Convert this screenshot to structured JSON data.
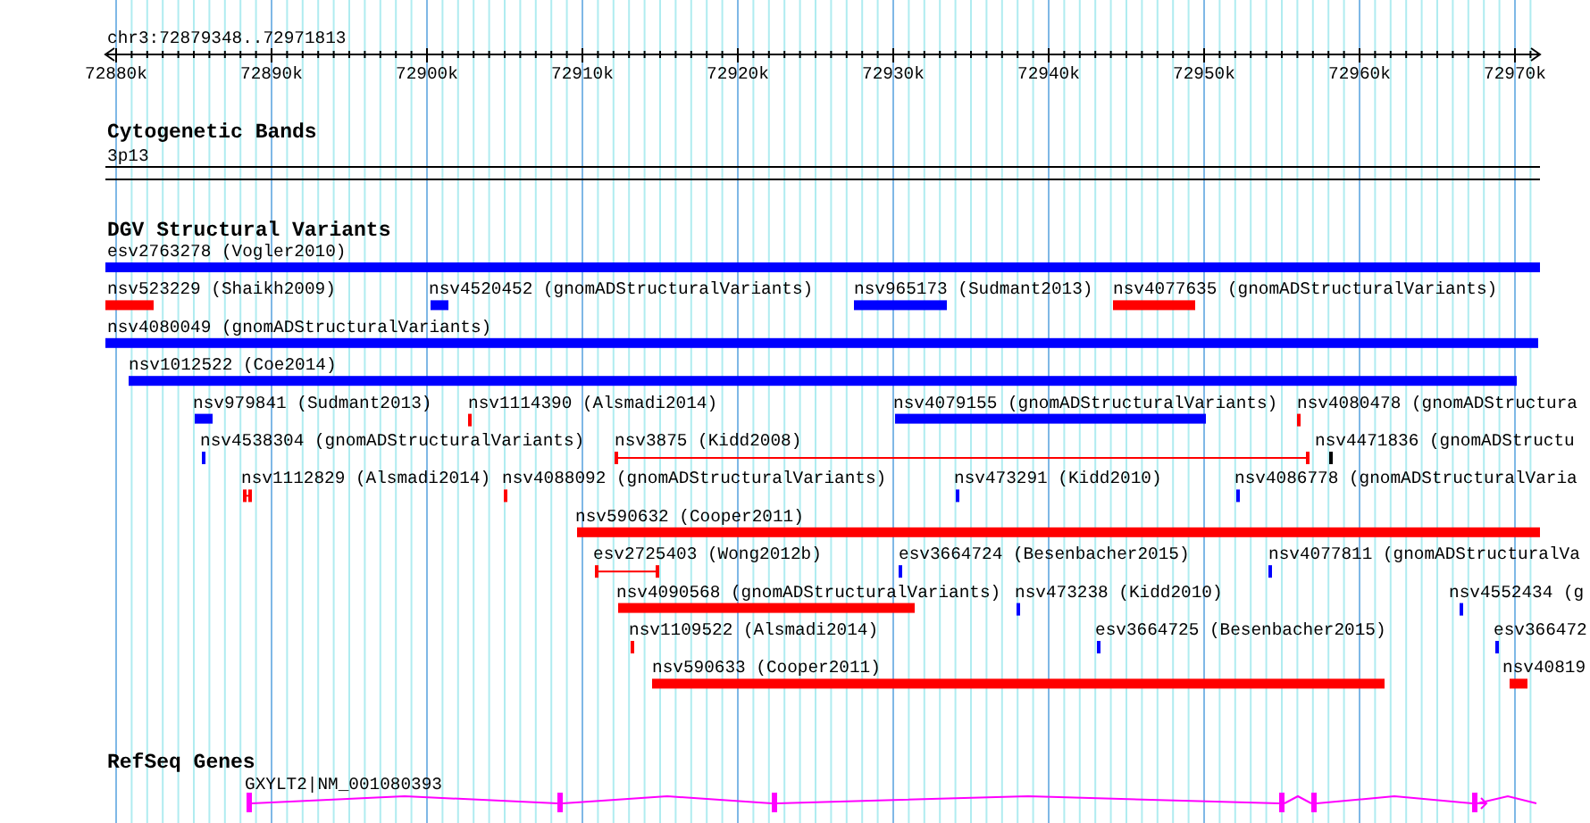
{
  "location": "chr3:72879348..72971813",
  "scale": {
    "labels": [
      "72880k",
      "72890k",
      "72900k",
      "72910k",
      "72920k",
      "72930k",
      "72940k",
      "72950k",
      "72960k",
      "72970k"
    ]
  },
  "tracks": [
    {
      "kind": "cytoband",
      "title": "Cytogenetic Bands",
      "band": "3p13"
    },
    {
      "kind": "variants",
      "title": "DGV Structural Variants",
      "features": [
        {
          "label": "esv2763278 (Vogler2010)",
          "color": "#0000ff",
          "kind": "bar"
        },
        {
          "label": "nsv523229 (Shaikh2009)",
          "color": "#ff0000",
          "kind": "bar"
        },
        {
          "label": "nsv4520452 (gnomADStructuralVariants)",
          "color": "#0000ff",
          "kind": "bar"
        },
        {
          "label": "nsv965173 (Sudmant2013)",
          "color": "#0000ff",
          "kind": "bar"
        },
        {
          "label": "nsv4077635 (gnomADStructuralVariants)",
          "color": "#ff0000",
          "kind": "bar"
        },
        {
          "label": "nsv4080049 (gnomADStructuralVariants)",
          "color": "#0000ff",
          "kind": "bar"
        },
        {
          "label": "nsv1012522 (Coe2014)",
          "color": "#0000ff",
          "kind": "bar"
        },
        {
          "label": "nsv979841 (Sudmant2013)",
          "color": "#0000ff",
          "kind": "bar"
        },
        {
          "label": "nsv1114390 (Alsmadi2014)",
          "color": "#ff0000",
          "kind": "tick"
        },
        {
          "label": "nsv4079155 (gnomADStructuralVariants)",
          "color": "#0000ff",
          "kind": "bar"
        },
        {
          "label": "nsv4080478 (gnomADStructura",
          "color": "#ff0000",
          "kind": "tick"
        },
        {
          "label": "nsv4538304 (gnomADStructuralVariants)",
          "color": "#0000ff",
          "kind": "tick"
        },
        {
          "label": "nsv3875 (Kidd2008)",
          "color": "#ff0000",
          "kind": "span"
        },
        {
          "label": "nsv4471836 (gnomADStructu",
          "color": "#000000",
          "kind": "tick"
        },
        {
          "label": "nsv1112829 (Alsmadi2014)",
          "color": "#ff0000",
          "kind": "span"
        },
        {
          "label": "nsv4088092 (gnomADStructuralVariants)",
          "color": "#ff0000",
          "kind": "tick"
        },
        {
          "label": "nsv473291 (Kidd2010)",
          "color": "#0000ff",
          "kind": "tick"
        },
        {
          "label": "nsv4086778 (gnomADStructuralVaria",
          "color": "#0000ff",
          "kind": "tick"
        },
        {
          "label": "nsv590632 (Cooper2011)",
          "color": "#ff0000",
          "kind": "bar"
        },
        {
          "label": "esv2725403 (Wong2012b)",
          "color": "#ff0000",
          "kind": "span"
        },
        {
          "label": "esv3664724 (Besenbacher2015)",
          "color": "#0000ff",
          "kind": "tick"
        },
        {
          "label": "nsv4077811 (gnomADStructuralVa",
          "color": "#0000ff",
          "kind": "tick"
        },
        {
          "label": "nsv4090568 (gnomADStructuralVariants)",
          "color": "#ff0000",
          "kind": "bar"
        },
        {
          "label": "nsv473238 (Kidd2010)",
          "color": "#0000ff",
          "kind": "tick"
        },
        {
          "label": "nsv4552434 (g",
          "color": "#0000ff",
          "kind": "tick"
        },
        {
          "label": "nsv1109522 (Alsmadi2014)",
          "color": "#ff0000",
          "kind": "tick"
        },
        {
          "label": "esv3664725 (Besenbacher2015)",
          "color": "#0000ff",
          "kind": "tick"
        },
        {
          "label": "esv366472",
          "color": "#0000ff",
          "kind": "tick"
        },
        {
          "label": "nsv590633 (Cooper2011)",
          "color": "#ff0000",
          "kind": "bar"
        },
        {
          "label": "nsv40819",
          "color": "#ff0000",
          "kind": "bar"
        }
      ]
    },
    {
      "kind": "genes",
      "title": "RefSeq Genes",
      "genes": [
        {
          "label": "GXYLT2|NM_001080393"
        }
      ]
    }
  ]
}
